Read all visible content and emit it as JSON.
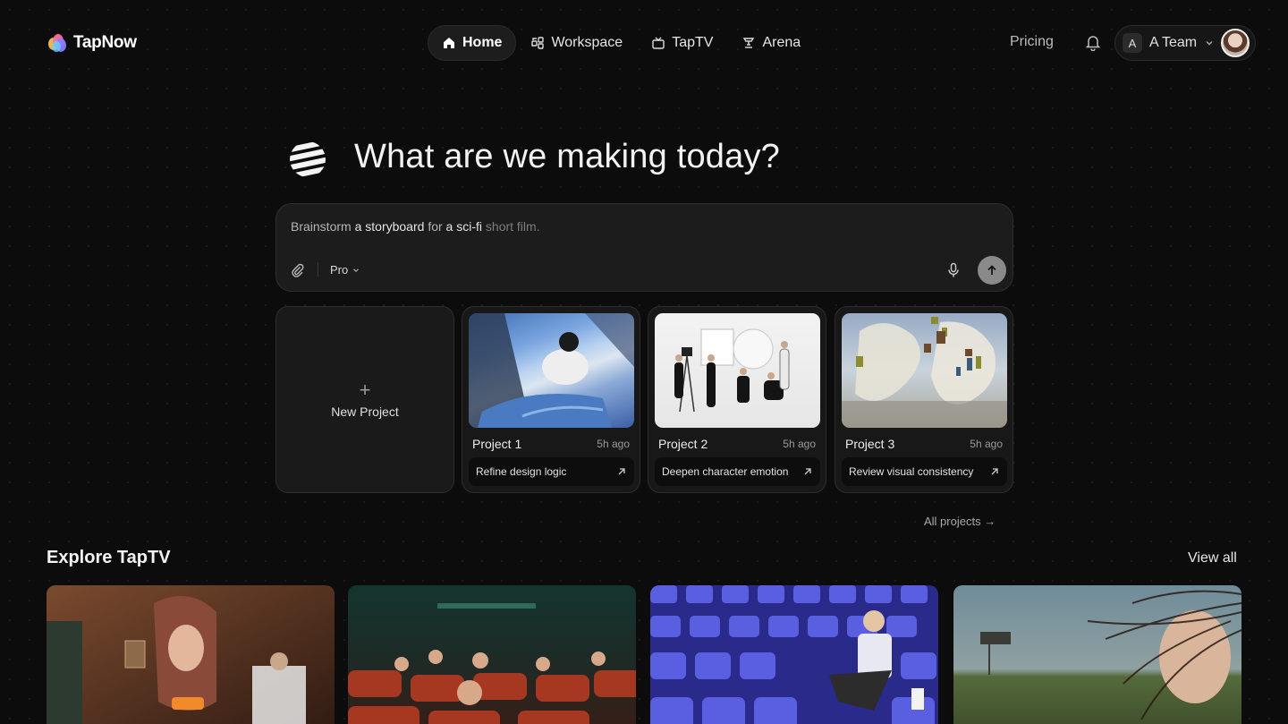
{
  "brand": {
    "name": "TapNow"
  },
  "nav": {
    "items": [
      {
        "label": "Home",
        "icon": "home-icon",
        "active": true
      },
      {
        "label": "Workspace",
        "icon": "workspace-icon",
        "active": false
      },
      {
        "label": "TapTV",
        "icon": "tv-icon",
        "active": false
      },
      {
        "label": "Arena",
        "icon": "arena-icon",
        "active": false
      }
    ]
  },
  "header": {
    "pricing_label": "Pricing",
    "team": {
      "letter": "A",
      "name": "A Team"
    }
  },
  "hero": {
    "title": "What are we making today?"
  },
  "prompt": {
    "placeholder_parts": [
      "Brainstorm ",
      "a ",
      "storyboard ",
      "for ",
      "a ",
      "sci-fi ",
      "short film."
    ],
    "model_label": "Pro"
  },
  "projects": {
    "new_label": "New Project",
    "items": [
      {
        "name": "Project 1",
        "time": "5h ago",
        "action": "Refine design logic"
      },
      {
        "name": "Project 2",
        "time": "5h ago",
        "action": "Deepen character emotion"
      },
      {
        "name": "Project 3",
        "time": "5h ago",
        "action": "Review visual consistency"
      }
    ],
    "all_label": "All projects →"
  },
  "explore": {
    "title": "Explore TapTV",
    "view_all_label": "View all"
  },
  "colors": {
    "background": "#0c0c0c",
    "surface": "#1c1c1c",
    "accent_send": "#8a8a8a"
  }
}
